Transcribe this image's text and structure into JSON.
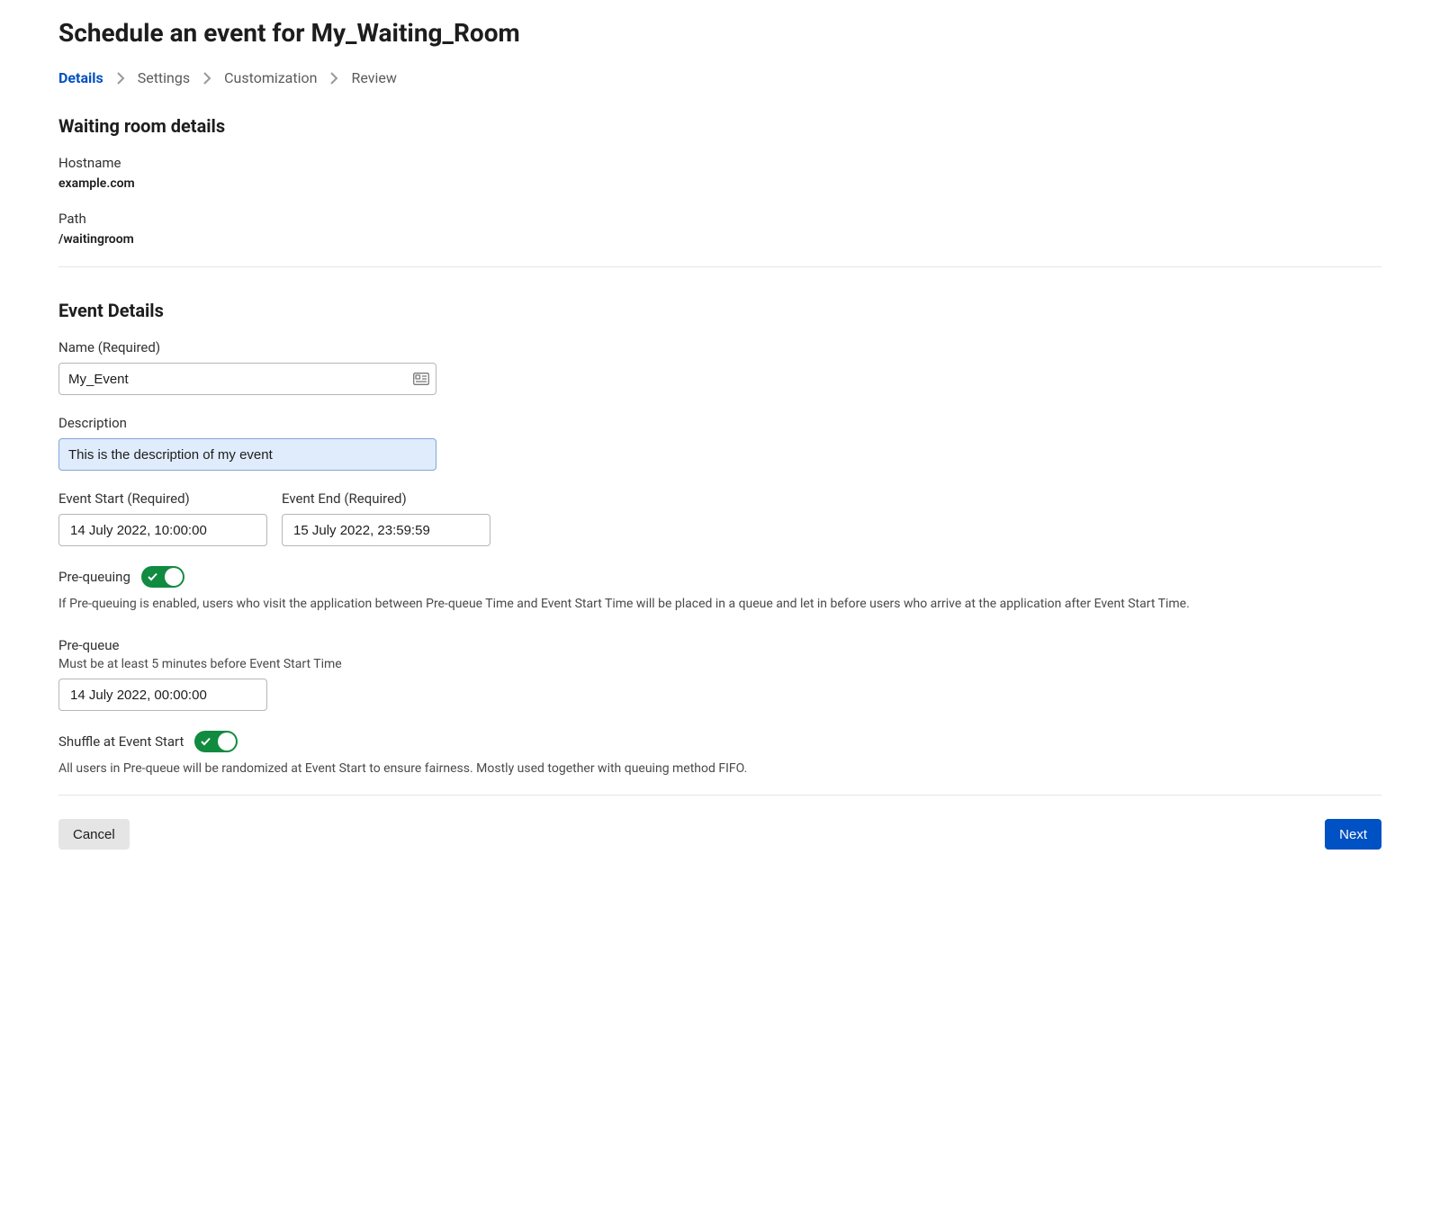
{
  "pageTitle": "Schedule an event for My_Waiting_Room",
  "breadcrumb": {
    "items": [
      {
        "label": "Details",
        "active": true
      },
      {
        "label": "Settings",
        "active": false
      },
      {
        "label": "Customization",
        "active": false
      },
      {
        "label": "Review",
        "active": false
      }
    ]
  },
  "waitingRoom": {
    "sectionTitle": "Waiting room details",
    "hostnameLabel": "Hostname",
    "hostnameValue": "example.com",
    "pathLabel": "Path",
    "pathValue": "/waitingroom"
  },
  "eventDetails": {
    "sectionTitle": "Event Details",
    "nameLabel": "Name (Required)",
    "nameValue": "My_Event",
    "descriptionLabel": "Description",
    "descriptionValue": "This is the description of my event",
    "eventStartLabel": "Event Start (Required)",
    "eventStartValue": "14 July 2022, 10:00:00",
    "eventEndLabel": "Event End (Required)",
    "eventEndValue": "15 July 2022, 23:59:59",
    "preQueuingLabel": "Pre-queuing",
    "preQueuingEnabled": true,
    "preQueuingDescription": "If Pre-queuing is enabled, users who visit the application between Pre-queue Time and Event Start Time will be placed in a queue and let in before users who arrive at the application after Event Start Time.",
    "preQueueLabel": "Pre-queue",
    "preQueueHint": "Must be at least 5 minutes before Event Start Time",
    "preQueueValue": "14 July 2022, 00:00:00",
    "shuffleLabel": "Shuffle at Event Start",
    "shuffleEnabled": true,
    "shuffleDescription": "All users in Pre-queue will be randomized at Event Start to ensure fairness. Mostly used together with queuing method FIFO."
  },
  "buttons": {
    "cancel": "Cancel",
    "next": "Next"
  }
}
